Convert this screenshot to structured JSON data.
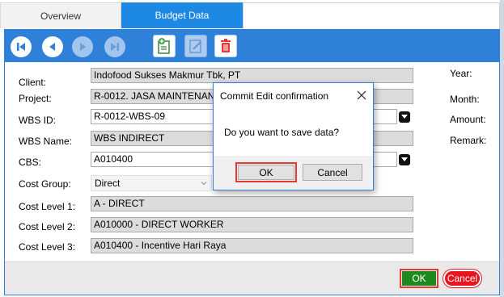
{
  "tabs": [
    {
      "label": "Overview",
      "active": false
    },
    {
      "label": "Budget Data",
      "active": true
    }
  ],
  "toolbar": {
    "nav_icons": [
      "first-record-icon",
      "previous-record-icon",
      "next-record-icon",
      "last-record-icon"
    ],
    "action_icons": [
      "add-document-icon",
      "edit-document-icon",
      "delete-trash-icon"
    ]
  },
  "form": {
    "client_label": "Client:",
    "client_value": "Indofood Sukses Makmur Tbk, PT",
    "project_label": "Project:",
    "project_value": "R-0012. JASA MAINTENANCE",
    "wbs_id_label": "WBS ID:",
    "wbs_id_value": "R-0012-WBS-09",
    "wbs_name_label": "WBS Name:",
    "wbs_name_value": "WBS INDIRECT",
    "cbs_label": "CBS:",
    "cbs_value": "A010400",
    "cost_group_label": "Cost Group:",
    "cost_group_value": "Direct",
    "cost_level1_label": "Cost Level 1:",
    "cost_level1_value": "A - DIRECT",
    "cost_level2_label": "Cost Level 2:",
    "cost_level2_value": "A010000 - DIRECT WORKER",
    "cost_level3_label": "Cost Level 3:",
    "cost_level3_value": "A010400 - Incentive Hari Raya",
    "year_label": "Year:",
    "month_label": "Month:",
    "amount_label": "Amount:",
    "remark_label": "Remark:"
  },
  "bottom": {
    "ok_label": "OK",
    "cancel_label": "Cancel"
  },
  "dialog": {
    "title": "Commit Edit confirmation",
    "message": "Do you want to save data?",
    "ok_label": "OK",
    "cancel_label": "Cancel"
  },
  "colors": {
    "accent": "#2f80d8",
    "tab_active": "#1e88e5",
    "ok_green": "#1e8a1e",
    "cancel_red": "#e8141e",
    "highlight_red": "#e53935"
  }
}
